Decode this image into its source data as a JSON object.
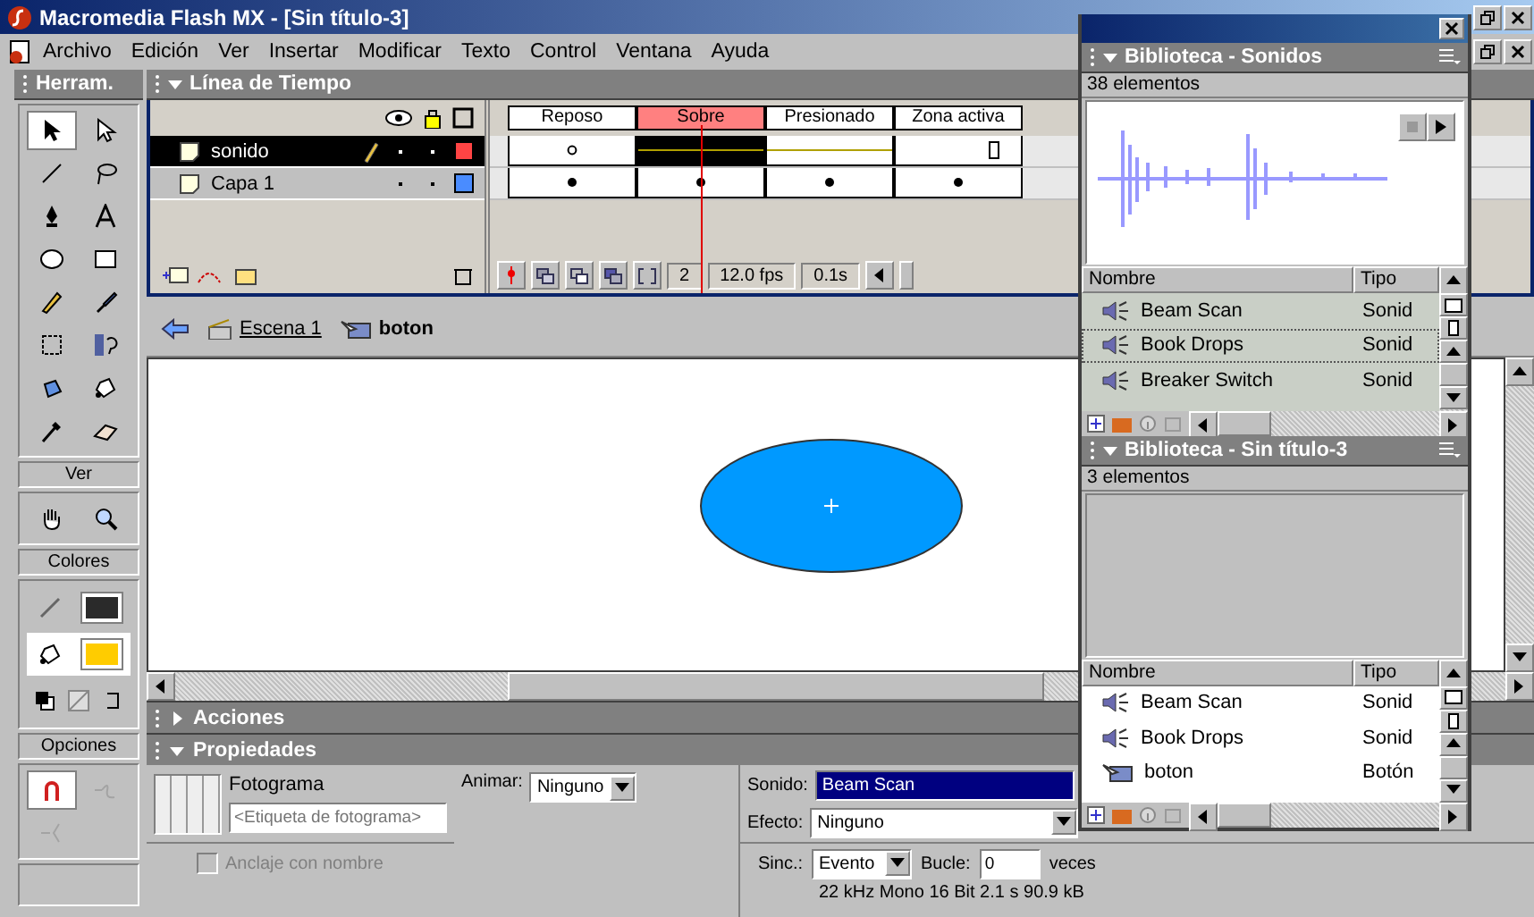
{
  "window": {
    "title": "Macromedia Flash MX - [Sin título-3]"
  },
  "menu": [
    {
      "label": "Archivo"
    },
    {
      "label": "Edición"
    },
    {
      "label": "Ver"
    },
    {
      "label": "Insertar"
    },
    {
      "label": "Modificar"
    },
    {
      "label": "Texto"
    },
    {
      "label": "Control"
    },
    {
      "label": "Ventana"
    },
    {
      "label": "Ayuda"
    }
  ],
  "toolbox": {
    "title": "Herram.",
    "tools": [
      {
        "kind": "arrow",
        "selected": true
      },
      {
        "kind": "subselect",
        "selected": false
      },
      {
        "kind": "line",
        "selected": false
      },
      {
        "kind": "lasso",
        "selected": false
      },
      {
        "kind": "pen",
        "selected": false
      },
      {
        "kind": "text",
        "selected": false
      },
      {
        "kind": "oval",
        "selected": false
      },
      {
        "kind": "rect",
        "selected": false
      },
      {
        "kind": "pencil",
        "selected": false
      },
      {
        "kind": "brush",
        "selected": false
      },
      {
        "kind": "transform",
        "selected": false
      },
      {
        "kind": "gradient",
        "selected": false
      },
      {
        "kind": "ink",
        "selected": false
      },
      {
        "kind": "bucket",
        "selected": false
      },
      {
        "kind": "dropper",
        "selected": false
      },
      {
        "kind": "eraser",
        "selected": false
      }
    ],
    "view": {
      "title": "Ver",
      "tools": [
        {
          "kind": "hand",
          "selected": false
        },
        {
          "kind": "zoom",
          "selected": false
        }
      ]
    },
    "colors": {
      "title": "Colores",
      "stroke": {
        "color": "#2a2a2a",
        "selected": false
      },
      "fill": {
        "color": "#ffcc00",
        "selected": true
      }
    },
    "options": {
      "title": "Opciones",
      "tools": [
        {
          "kind": "magnet",
          "selected": true,
          "disabled": false
        },
        {
          "kind": "smooth",
          "selected": false,
          "disabled": true
        },
        {
          "kind": "straighten",
          "selected": false,
          "disabled": true
        }
      ]
    }
  },
  "timeline": {
    "title": "Línea de Tiempo",
    "frame_labels": [
      {
        "label": "Reposo",
        "selected": false
      },
      {
        "label": "Sobre",
        "selected": true
      },
      {
        "label": "Presionado",
        "selected": false
      },
      {
        "label": "Zona activa",
        "selected": false
      }
    ],
    "layers": [
      {
        "name": "sonido",
        "selected": true,
        "color": "#ff4444",
        "frames": [
          {
            "kind": "empty-key"
          },
          {
            "kind": "sound"
          },
          {
            "kind": "sound"
          },
          {
            "kind": "sound-end"
          }
        ]
      },
      {
        "name": "Capa 1",
        "selected": false,
        "color": "#4a8cff",
        "frames": [
          {
            "kind": "key"
          },
          {
            "kind": "key"
          },
          {
            "kind": "key"
          },
          {
            "kind": "key"
          }
        ]
      }
    ],
    "current_frame": "2",
    "frame_rate": "12.0 fps",
    "elapsed": "0.1s"
  },
  "breadcrumb": {
    "scene": "Escena 1",
    "symbol": "boton"
  },
  "panels": [
    {
      "title": "Acciones",
      "expanded": false
    },
    {
      "title": "Propiedades",
      "expanded": true
    }
  ],
  "properties": {
    "type": "Fotograma",
    "label_placeholder": "<Etiqueta de fotograma>",
    "tween_label": "Animar:",
    "tween": "Ninguno",
    "anchor": {
      "label": "Anclaje con nombre",
      "checked": false,
      "disabled": true
    },
    "sound_label": "Sonido:",
    "sound": "Beam Scan",
    "effect_label": "Efecto:",
    "effect": "Ninguno",
    "sync_label": "Sinc.:",
    "sync": "Evento",
    "loop_label": "Bucle:",
    "loop": "0",
    "loop_unit": "veces",
    "info": "22 kHz Mono 16 Bit 2.1 s 90.9 kB"
  },
  "libraries": [
    {
      "title": "Biblioteca - Sonidos",
      "count": "38 elementos",
      "preview": {
        "kind": "waveform"
      },
      "active": false,
      "columns": [
        "Nombre",
        "Tipo"
      ],
      "items": [
        {
          "name": "Beam Scan",
          "type": "Sonid",
          "kind": "sound",
          "selected": false
        },
        {
          "name": "Book Drops",
          "type": "Sonid",
          "kind": "sound",
          "selected": true
        },
        {
          "name": "Breaker Switch",
          "type": "Sonid",
          "kind": "sound",
          "selected": false
        }
      ]
    },
    {
      "title": "Biblioteca - Sin título-3",
      "count": "3 elementos",
      "preview": {
        "kind": "blank"
      },
      "active": true,
      "columns": [
        "Nombre",
        "Tipo"
      ],
      "items": [
        {
          "name": "Beam Scan",
          "type": "Sonid",
          "kind": "sound",
          "selected": false
        },
        {
          "name": "Book Drops",
          "type": "Sonid",
          "kind": "sound",
          "selected": false
        },
        {
          "name": "boton",
          "type": "Botón",
          "kind": "button",
          "selected": false
        }
      ]
    }
  ]
}
